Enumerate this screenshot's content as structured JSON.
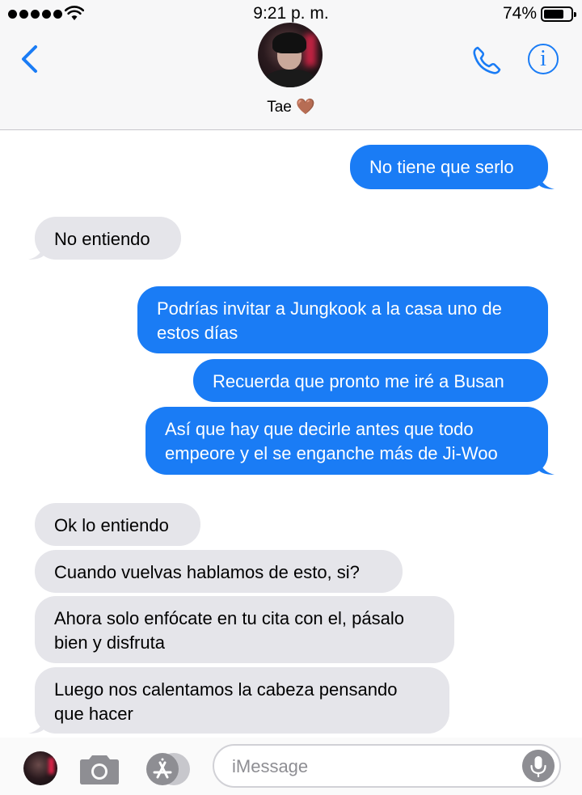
{
  "status_bar": {
    "time": "9:21 p. m.",
    "battery_percent": "74%",
    "battery_level": 0.74
  },
  "header": {
    "contact_name": "Tae 🤎"
  },
  "messages": [
    {
      "direction": "outgoing",
      "text": "No tiene que serlo",
      "tail": true
    },
    {
      "direction": "incoming",
      "text": "No entiendo",
      "tail": true
    },
    {
      "direction": "outgoing",
      "text": "Podrías invitar a Jungkook a la casa uno de estos días",
      "tail": false
    },
    {
      "direction": "outgoing",
      "text": "Recuerda que pronto me iré a Busan",
      "tail": false
    },
    {
      "direction": "outgoing",
      "text": "Así que hay que decirle antes que todo empeore y el se enganche más de Ji-Woo",
      "tail": true
    },
    {
      "direction": "incoming",
      "text": "Ok lo entiendo",
      "tail": false
    },
    {
      "direction": "incoming",
      "text": "Cuando vuelvas hablamos de esto, si?",
      "tail": false
    },
    {
      "direction": "incoming",
      "text": "Ahora solo enfócate en tu cita con el, pásalo bien y disfruta",
      "tail": false
    },
    {
      "direction": "incoming",
      "text": "Luego nos calentamos la cabeza pensando que hacer",
      "tail": true
    }
  ],
  "composer": {
    "placeholder": "iMessage",
    "value": ""
  },
  "colors": {
    "accent": "#1a7cf5",
    "outgoing_bubble": "#1a7cf5",
    "incoming_bubble": "#e5e5ea",
    "header_bg": "#f7f7f8"
  },
  "icons": {
    "back": "chevron-left-icon",
    "phone": "phone-icon",
    "info": "info-icon",
    "camera": "camera-icon",
    "apps": "app-store-icon",
    "mic": "microphone-icon",
    "wifi": "wifi-icon",
    "battery": "battery-icon"
  }
}
